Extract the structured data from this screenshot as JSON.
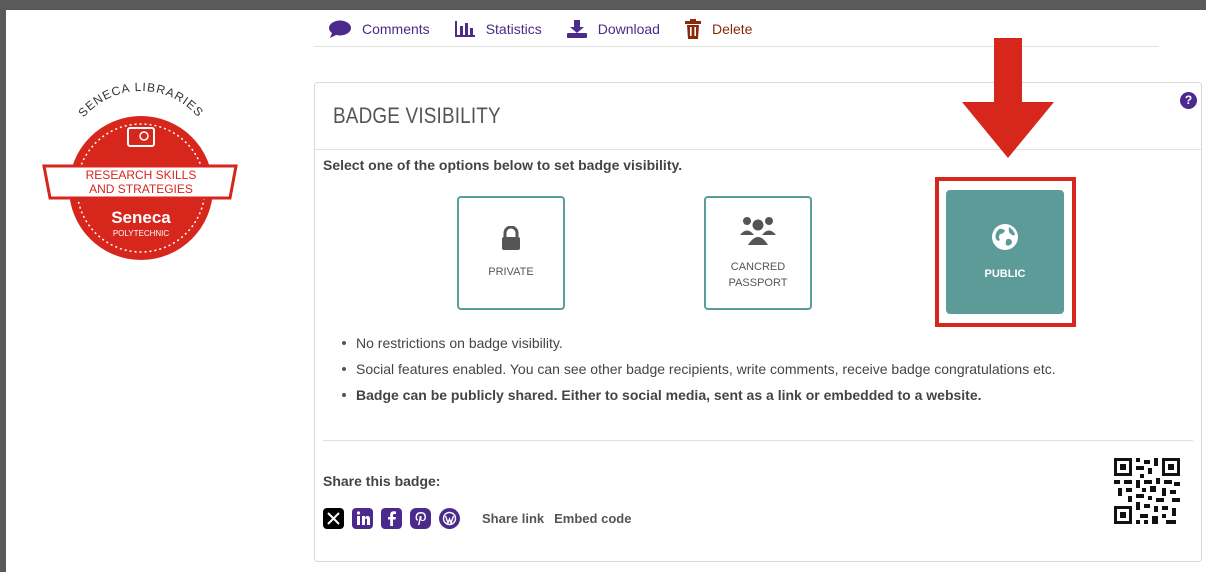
{
  "toolbar": {
    "comments_label": "Comments",
    "statistics_label": "Statistics",
    "download_label": "Download",
    "delete_label": "Delete"
  },
  "badge_logo": {
    "top_text": "SENECA LIBRARIES",
    "line1": "RESEARCH SKILLS",
    "line2": "AND STRATEGIES",
    "brand": "Seneca",
    "sub": "POLYTECHNIC"
  },
  "panel": {
    "title": "BADGE VISIBILITY",
    "help": "?",
    "instruction": "Select one of the options below to set badge visibility.",
    "options": [
      {
        "label": "PRIVATE",
        "icon": "lock-icon"
      },
      {
        "label_line1": "CANCRED",
        "label_line2": "PASSPORT",
        "icon": "users-icon"
      },
      {
        "label": "PUBLIC",
        "icon": "globe-icon",
        "selected": true
      }
    ],
    "bullets": [
      "No restrictions on badge visibility.",
      "Social features enabled. You can see other badge recipients, write comments, receive badge congratulations etc.",
      "Badge can be publicly shared. Either to social media, sent as a link or embedded to a website."
    ]
  },
  "share": {
    "title": "Share this badge:",
    "share_link": "Share link",
    "embed_code": "Embed code"
  },
  "colors": {
    "accent_purple": "#4b2a8c",
    "teal": "#5c9b98",
    "highlight_red": "#d7261c",
    "delete_brown": "#8b2a0a"
  }
}
